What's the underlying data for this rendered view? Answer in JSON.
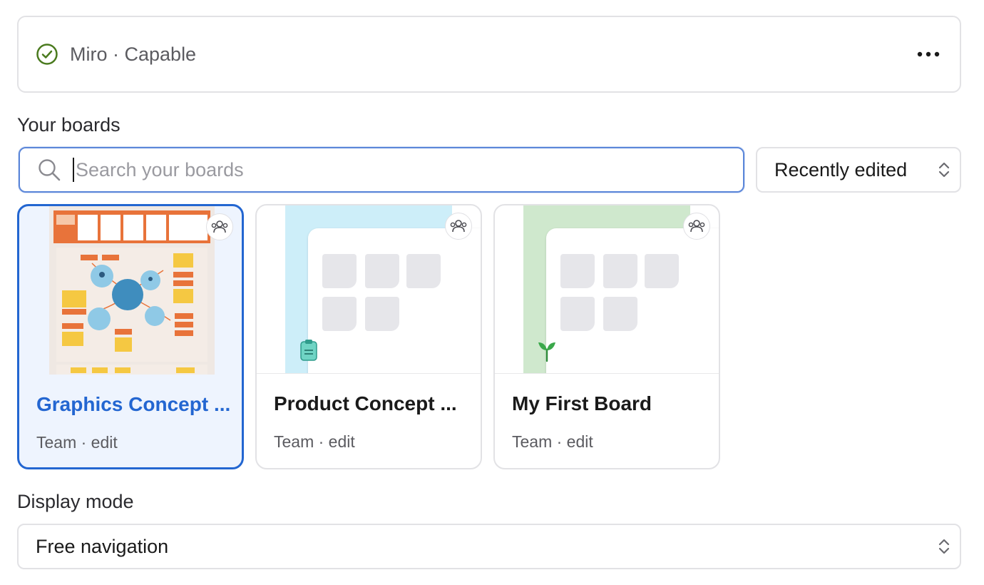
{
  "integration": {
    "name": "Miro",
    "separator": " · ",
    "status": "Capable",
    "status_color": "#4a7a1e"
  },
  "boards_section": {
    "label": "Your boards",
    "search": {
      "placeholder": "Search your boards",
      "value": ""
    },
    "sort": {
      "selected": "Recently edited"
    },
    "items": [
      {
        "title": "Graphics Concept ...",
        "meta": "Team · edit",
        "selected": true,
        "thumbnail": "mind-map"
      },
      {
        "title": "Product Concept ...",
        "meta": "Team · edit",
        "selected": false,
        "thumbnail": "template-cyan",
        "icon": "clipboard-icon"
      },
      {
        "title": "My First Board",
        "meta": "Team · edit",
        "selected": false,
        "thumbnail": "template-green",
        "icon": "sprout-icon"
      }
    ]
  },
  "display_mode": {
    "label": "Display mode",
    "selected": "Free navigation"
  },
  "colors": {
    "accent": "#2366d1",
    "border": "#e2e2e5",
    "cyan_strip": "#cdeef9",
    "green_strip": "#cfe8cd"
  }
}
